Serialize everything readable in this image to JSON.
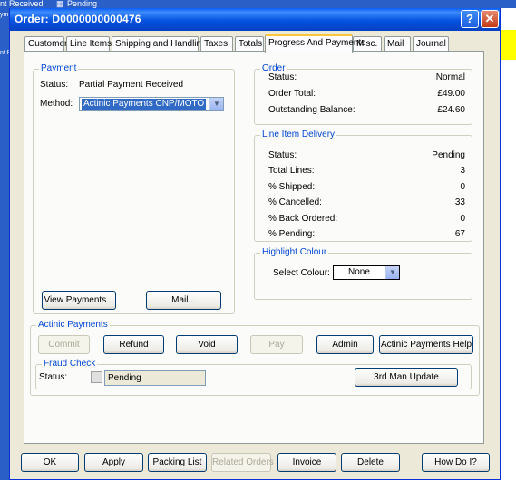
{
  "background": {
    "status_text": "nt Received",
    "pending_text": "Pending",
    "left_text_1": "ym",
    "left_text_2": "nt R"
  },
  "window": {
    "title": "Order: D0000000000476"
  },
  "tabs": [
    {
      "label": "Customer"
    },
    {
      "label": "Line Items"
    },
    {
      "label": "Shipping and Handling"
    },
    {
      "label": "Taxes"
    },
    {
      "label": "Totals"
    },
    {
      "label": "Progress And Payments"
    },
    {
      "label": "Misc."
    },
    {
      "label": "Mail"
    },
    {
      "label": "Journal"
    }
  ],
  "payment": {
    "group_title": "Payment",
    "status_label": "Status:",
    "status_value": "Partial Payment Received",
    "method_label": "Method:",
    "method_value": "Actinic Payments CNP/MOTO",
    "view_payments_label": "View Payments...",
    "mail_label": "Mail..."
  },
  "order": {
    "group_title": "Order",
    "rows": [
      {
        "label": "Status:",
        "value": "Normal"
      },
      {
        "label": "Order Total:",
        "value": "£49.00"
      },
      {
        "label": "Outstanding Balance:",
        "value": "£24.60"
      }
    ]
  },
  "line_item_delivery": {
    "group_title": "Line Item Delivery",
    "rows": [
      {
        "label": "Status:",
        "value": "Pending"
      },
      {
        "label": "Total Lines:",
        "value": "3"
      },
      {
        "label": "% Shipped:",
        "value": "0"
      },
      {
        "label": "% Cancelled:",
        "value": "33"
      },
      {
        "label": "% Back Ordered:",
        "value": "0"
      },
      {
        "label": "% Pending:",
        "value": "67"
      }
    ]
  },
  "highlight": {
    "group_title": "Highlight Colour",
    "select_label": "Select Colour:",
    "colour_value": "None"
  },
  "actinic": {
    "group_title": "Actinic Payments",
    "commit_label": "Commit",
    "refund_label": "Refund",
    "void_label": "Void",
    "pay_label": "Pay",
    "admin_label": "Admin",
    "help_label": "Actinic Payments Help"
  },
  "fraud": {
    "group_title": "Fraud Check",
    "status_label": "Status:",
    "status_value": "Pending",
    "update_label": "3rd Man Update"
  },
  "footer": {
    "ok_label": "OK",
    "apply_label": "Apply",
    "packing_label": "Packing List",
    "related_label": "Related Orders",
    "invoice_label": "Invoice",
    "delete_label": "Delete",
    "howdoi_label": "How Do I?"
  },
  "colors": {
    "title_blue": "#0553e0",
    "group_title_blue": "#0046d5",
    "highlight_yellow": "#ffff00"
  }
}
